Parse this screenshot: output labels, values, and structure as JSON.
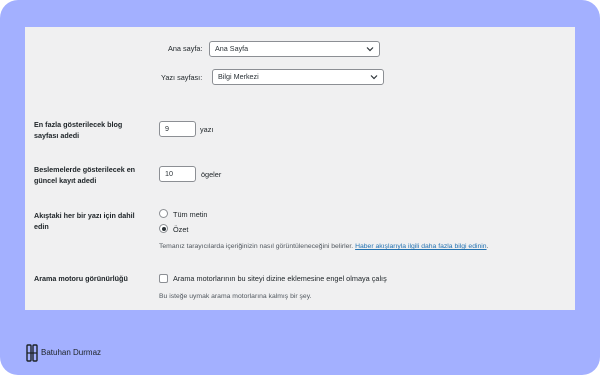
{
  "homepage": {
    "label": "Ana sayfa:",
    "value": "Ana Sayfa"
  },
  "postspage": {
    "label": "Yazı sayfası:",
    "value": "Bilgi Merkezi"
  },
  "blog_pages": {
    "label_line1": "En fazla gösterilecek blog",
    "label_line2": "sayfası adedi",
    "value": "9",
    "suffix": "yazı"
  },
  "feed_items": {
    "label_line1": "Beslemelerde gösterilecek en",
    "label_line2": "güncel kayıt adedi",
    "value": "10",
    "suffix": "ögeler"
  },
  "feed_content": {
    "label_line1": "Akıştaki her bir yazı için dahil",
    "label_line2": "edin",
    "option_full": "Tüm metin",
    "option_summary": "Özet",
    "selected": "Özet",
    "description": "Temanız tarayıcılarda içeriğinizin nasıl görüntüleneceğini belirler.",
    "link": "Haber akışlarıyla ilgili daha fazla bilgi edinin",
    "link_end": "."
  },
  "search_visibility": {
    "label": "Arama motoru görünürlüğü",
    "checkbox_label": "Arama motorlarının bu siteyi dizine eklemesine engel olmaya çalış",
    "checked": false,
    "description": "Bu isteğe uymak arama motorlarına kalmış bir şey."
  },
  "footer": {
    "brand_name": "Batuhan Durmaz"
  },
  "colors": {
    "frame": "#a3b0ff",
    "panel": "#f0f0f1",
    "link": "#2271b1"
  }
}
